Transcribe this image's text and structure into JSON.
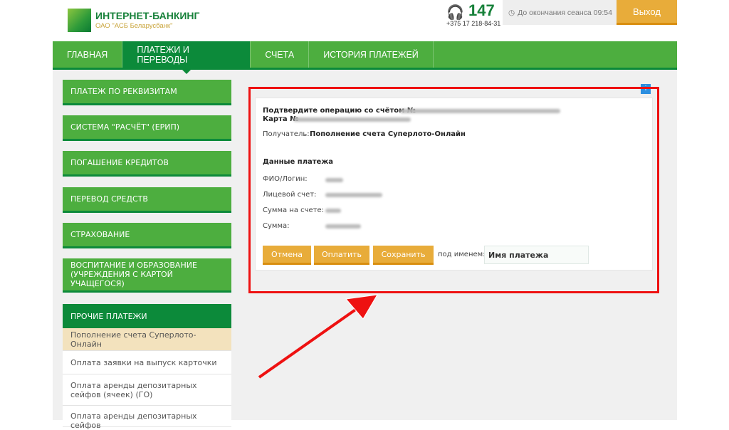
{
  "header": {
    "title": "ИНТЕРНЕТ-БАНКИНГ",
    "subtitle": "ОАО \"АСБ Беларусбанк\"",
    "hotline": "147",
    "phone": "+375 17 218-84-31",
    "session": "До окончания сеанса 09:54",
    "logout": "Выход"
  },
  "nav": {
    "tabs": [
      {
        "label": "ГЛАВНАЯ"
      },
      {
        "label": "ПЛАТЕЖИ И ПЕРЕВОДЫ"
      },
      {
        "label": "СЧЕТА"
      },
      {
        "label": "ИСТОРИЯ ПЛАТЕЖЕЙ"
      }
    ]
  },
  "sidebar": {
    "items": [
      {
        "label": "ПЛАТЕЖ ПО РЕКВИЗИТАМ"
      },
      {
        "label": "СИСТЕМА \"РАСЧЁТ\" (ЕРИП)"
      },
      {
        "label": "ПОГАШЕНИЕ КРЕДИТОВ"
      },
      {
        "label": "ПЕРЕВОД СРЕДСТВ"
      },
      {
        "label": "СТРАХОВАНИЕ"
      },
      {
        "label": "ВОСПИТАНИЕ И ОБРАЗОВАНИЕ (УЧРЕЖДЕНИЯ С КАРТОЙ УЧАЩЕГОСЯ)"
      }
    ],
    "other_title": "ПРОЧИЕ ПЛАТЕЖИ",
    "other_items": [
      {
        "label": "Пополнение счета Суперлото-Онлайн"
      },
      {
        "label": "Оплата заявки на выпуск карточки"
      },
      {
        "label": "Оплата аренды депозитарных сейфов (ячеек) (ГО)"
      },
      {
        "label": "Оплата аренды депозитарных сейфов"
      }
    ]
  },
  "confirm": {
    "account_line": "Подтвердите операцию со счётом №",
    "card_line": "Карта №",
    "recipient_label": "Получатель:",
    "recipient": "Пополнение счета Суперлото-Онлайн",
    "section": "Данные платежа",
    "fields": [
      {
        "label": "ФИО/Логин:"
      },
      {
        "label": "Лицевой счет:"
      },
      {
        "label": "Сумма на счете:"
      },
      {
        "label": "Сумма:"
      }
    ],
    "cancel": "Отмена",
    "pay": "Оплатить",
    "save": "Сохранить",
    "save_as": "под именем:",
    "name_placeholder": "Имя платежа"
  },
  "colors": {
    "green": "#4dae3f",
    "dark_green": "#0c8a3a",
    "orange": "#e8ac3a",
    "highlight": "#f3e2bd",
    "annotation": "#ee1111"
  }
}
